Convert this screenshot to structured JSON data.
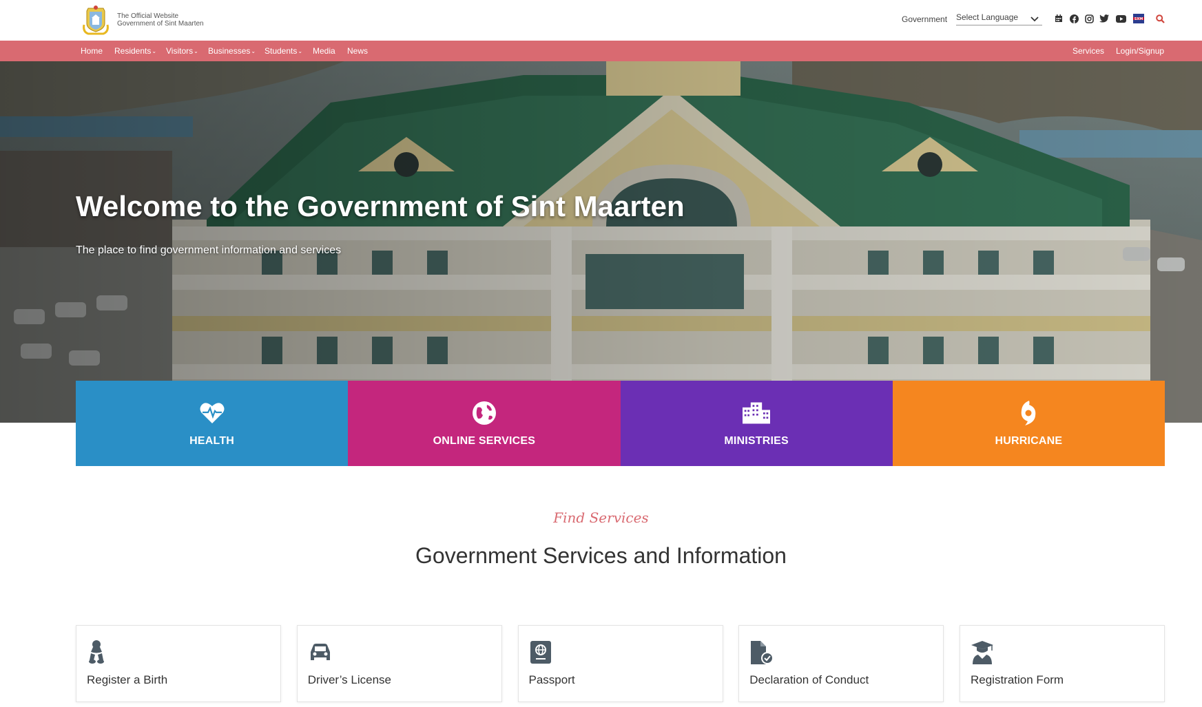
{
  "header": {
    "logo_line1": "The Official Website",
    "logo_line2": "Government of Sint Maarten",
    "government_link": "Government",
    "language_select": "Select Language",
    "icons": [
      "calendar-icon",
      "facebook-icon",
      "instagram-icon",
      "twitter-icon",
      "youtube-icon",
      "sxm-gov-icon",
      "search-icon"
    ]
  },
  "nav": {
    "left": [
      {
        "label": "Home",
        "dropdown": false
      },
      {
        "label": "Residents",
        "dropdown": true
      },
      {
        "label": "Visitors",
        "dropdown": true
      },
      {
        "label": "Businesses",
        "dropdown": true
      },
      {
        "label": "Students",
        "dropdown": true
      },
      {
        "label": "Media",
        "dropdown": false
      },
      {
        "label": "News",
        "dropdown": false
      }
    ],
    "right": [
      {
        "label": "Services"
      },
      {
        "label": "Login/Signup"
      }
    ]
  },
  "hero": {
    "title": "Welcome to the Government of Sint Maarten",
    "subtitle": "The place to find government information and services"
  },
  "tiles": [
    {
      "label": "HEALTH",
      "icon": "heart-pulse-icon",
      "color": "#2a8fc6"
    },
    {
      "label": "ONLINE SERVICES",
      "icon": "globe-icon",
      "color": "#c4267d"
    },
    {
      "label": "MINISTRIES",
      "icon": "buildings-icon",
      "color": "#6b2fb4"
    },
    {
      "label": "HURRICANE",
      "icon": "hurricane-icon",
      "color": "#f5861f"
    }
  ],
  "services_section": {
    "eyebrow": "Find Services",
    "title": "Government Services and Information"
  },
  "service_cards": [
    {
      "label": "Register a Birth",
      "icon": "baby-icon"
    },
    {
      "label": "Driver’s License",
      "icon": "car-icon"
    },
    {
      "label": "Passport",
      "icon": "passport-icon"
    },
    {
      "label": "Declaration of Conduct",
      "icon": "file-check-icon"
    },
    {
      "label": "Registration Form",
      "icon": "graduate-icon"
    }
  ],
  "colors": {
    "nav_bg": "#d96a71",
    "accent_red": "#d0453c",
    "icon_gray": "#4d5b66"
  }
}
